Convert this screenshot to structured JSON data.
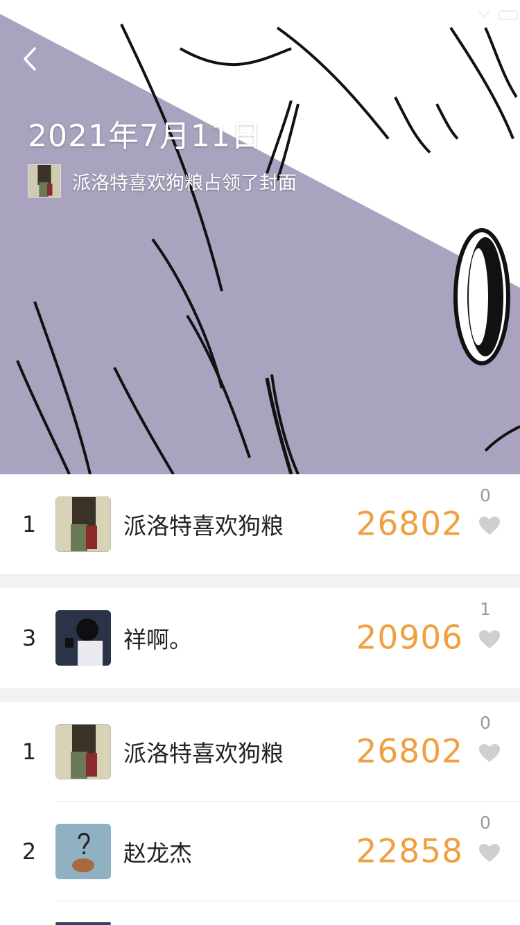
{
  "header": {
    "date_title": "2021年7月11日",
    "cover_text": "派洛特喜欢狗粮占领了封面"
  },
  "my_rank": {
    "rank": "1",
    "name": "派洛特喜欢狗粮",
    "steps": "26802",
    "likes": "0"
  },
  "friend_rank": {
    "rank": "3",
    "name": "祥啊。",
    "steps": "20906",
    "likes": "1"
  },
  "leaderboard": [
    {
      "rank": "1",
      "name": "派洛特喜欢狗粮",
      "steps": "26802",
      "likes": "0"
    },
    {
      "rank": "2",
      "name": "赵龙杰",
      "steps": "22858",
      "likes": "0"
    }
  ],
  "colors": {
    "accent_steps": "#f0a040",
    "cover_bg": "#a9a3bf",
    "heart": "#cfcfcf"
  },
  "icons": {
    "back": "chevron-left-icon",
    "like": "heart-icon"
  }
}
